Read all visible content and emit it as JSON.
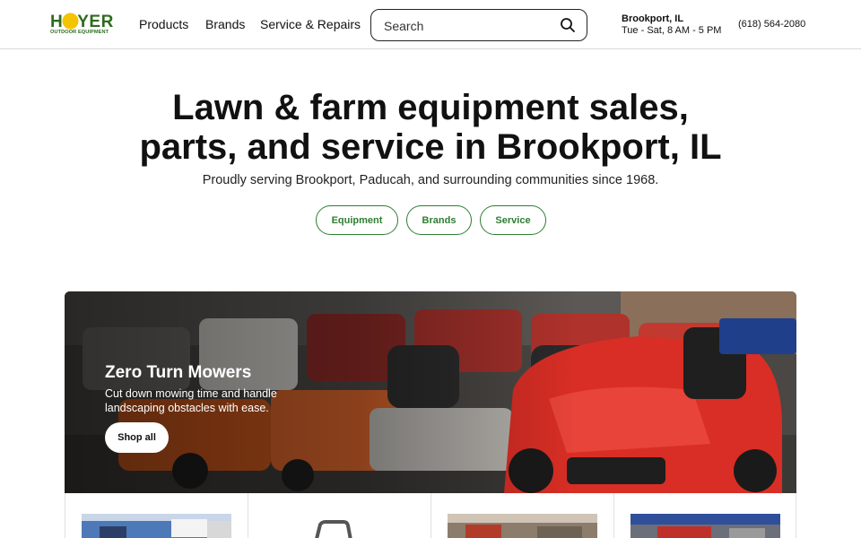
{
  "header": {
    "logo_text": "HOYER",
    "logo_subtext": "OUTDOOR EQUIPMENT",
    "nav": [
      {
        "label": "Products"
      },
      {
        "label": "Brands"
      },
      {
        "label": "Service & Repairs"
      }
    ],
    "search": {
      "placeholder": "Search",
      "icon": "search-icon"
    },
    "store": {
      "name": "Brookport, IL",
      "hours": "Tue - Sat, 8 AM - 5 PM"
    },
    "phone": "(618) 564-2080"
  },
  "hero": {
    "title_line1": "Lawn & farm equipment sales,",
    "title_line2": "parts, and service in Brookport, IL",
    "subtitle": "Proudly serving Brookport, Paducah, and surrounding communities since 1968.",
    "pills": [
      {
        "label": "Equipment"
      },
      {
        "label": "Brands"
      },
      {
        "label": "Service"
      }
    ]
  },
  "banner": {
    "title": "Zero Turn Mowers",
    "description": "Cut down mowing time and handle landscaping obstacles with ease.",
    "button": "Shop all"
  },
  "colors": {
    "brand_green": "#2e7d32",
    "logo_yellow": "#f5c400"
  }
}
